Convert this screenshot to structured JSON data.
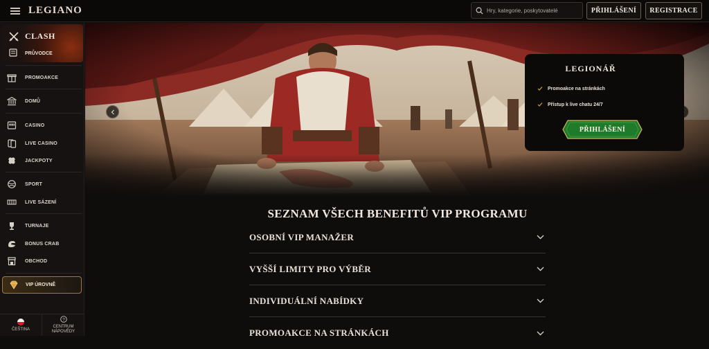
{
  "header": {
    "logo": "LEGIANO",
    "search_placeholder": "Hry, kategorie, poskytovatelé",
    "login_label": "PŘIHLÁŠENÍ",
    "register_label": "REGISTRACE"
  },
  "sidebar": {
    "clash": {
      "title": "CLASH",
      "subtitle": "PRŮVODCE"
    },
    "items": [
      {
        "label": "PROMOAKCE",
        "icon": "gift-icon"
      },
      {
        "label": "DOMŮ",
        "icon": "temple-icon"
      },
      {
        "label": "CASINO",
        "icon": "slot-machine-icon"
      },
      {
        "label": "LIVE CASINO",
        "icon": "cards-icon"
      },
      {
        "label": "JACKPOTY",
        "icon": "clover-icon"
      },
      {
        "label": "SPORT",
        "icon": "ball-icon"
      },
      {
        "label": "LIVE SÁZENÍ",
        "icon": "live-betting-icon"
      },
      {
        "label": "TURNAJE",
        "icon": "trophy-icon"
      },
      {
        "label": "BONUS CRAB",
        "icon": "crab-claw-icon"
      },
      {
        "label": "OBCHOD",
        "icon": "shop-icon"
      }
    ],
    "vip": {
      "label": "VIP ÚROVNĚ",
      "icon": "diamond-icon"
    },
    "language_label": "ČEŠTINA",
    "help_label_line1": "CENTRUM",
    "help_label_line2": "NÁPOVĚDY"
  },
  "hero": {
    "card_title": "LEGIONÁŘ",
    "perks": [
      "Promoakce na stránkách",
      "Přístup k live chatu 24/7"
    ],
    "button_label": "PŘIHLÁŠENÍ"
  },
  "benefits": {
    "title": "SEZNAM VŠECH BENEFITŮ VIP PROGRAMU",
    "items": [
      "OSOBNÍ VIP MANAŽER",
      "VYŠŠÍ LIMITY PRO VÝBĚR",
      "INDIVIDUÁLNÍ NABÍDKY",
      "PROMOAKCE NA STRÁNKÁCH"
    ]
  },
  "colors": {
    "accent_gold": "#a07c3c",
    "button_green": "#1f7a2a",
    "background": "#0f0d0c"
  }
}
